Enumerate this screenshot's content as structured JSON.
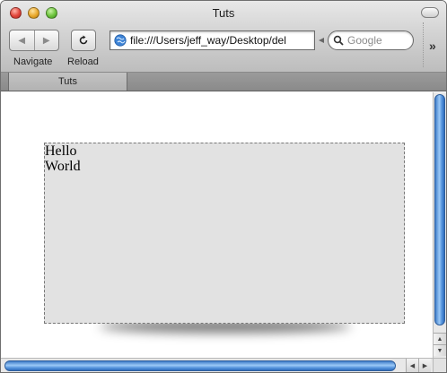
{
  "window": {
    "title": "Tuts"
  },
  "toolbar": {
    "navigate_label": "Navigate",
    "reload_label": "Reload",
    "back_glyph": "◀",
    "forward_glyph": "▶",
    "overflow_glyph": "»"
  },
  "address": {
    "url": "file:///Users/jeff_way/Desktop/del"
  },
  "search": {
    "placeholder": "Google"
  },
  "tabs": [
    {
      "label": "Tuts"
    }
  ],
  "content": {
    "box_line1": "Hello",
    "box_line2": "World"
  },
  "scroll": {
    "up_glyph": "▲",
    "down_glyph": "▼",
    "left_glyph": "◀",
    "right_glyph": "▶"
  },
  "colors": {
    "scroll_accent": "#5a98e0",
    "box_background": "#e2e2e2"
  }
}
